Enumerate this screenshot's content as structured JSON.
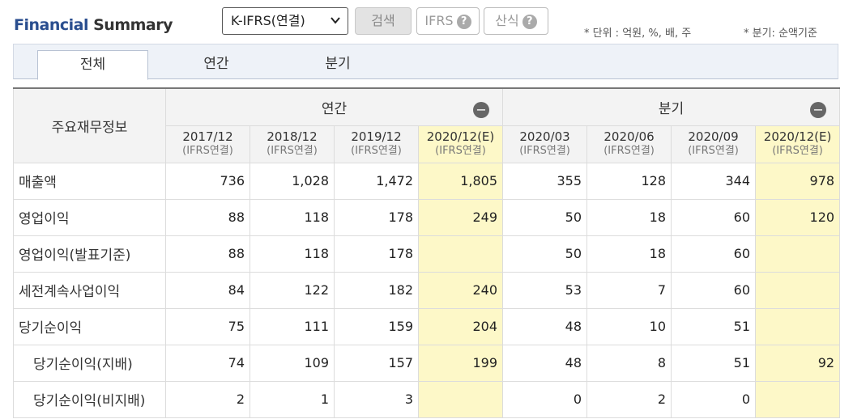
{
  "header": {
    "title_part1": "Financial",
    "title_part2": "Summary",
    "select_value": "K-IFRS(연결)",
    "search_label": "검색",
    "ifrs_label": "IFRS",
    "calc_label": "산식",
    "help_glyph": "?",
    "unit_note": "* 단위 : 억원, %, 배, 주",
    "quarter_note": "* 분기: 순액기준"
  },
  "tabs": [
    {
      "label": "전체",
      "active": true
    },
    {
      "label": "연간",
      "active": false
    },
    {
      "label": "분기",
      "active": false
    }
  ],
  "table": {
    "row_header": "주요재무정보",
    "annual_label": "연간",
    "quarter_label": "분기",
    "collapse_glyph": "−",
    "periods": [
      {
        "date": "2017/12",
        "basis": "(IFRS연결)"
      },
      {
        "date": "2018/12",
        "basis": "(IFRS연결)"
      },
      {
        "date": "2019/12",
        "basis": "(IFRS연결)"
      },
      {
        "date": "2020/12(E)",
        "basis": "(IFRS연결)"
      },
      {
        "date": "2020/03",
        "basis": "(IFRS연결)"
      },
      {
        "date": "2020/06",
        "basis": "(IFRS연결)"
      },
      {
        "date": "2020/09",
        "basis": "(IFRS연결)"
      },
      {
        "date": "2020/12(E)",
        "basis": "(IFRS연결)"
      }
    ],
    "rows": [
      {
        "label": "매출액",
        "indent": false,
        "values": [
          "736",
          "1,028",
          "1,472",
          "1,805",
          "355",
          "128",
          "344",
          "978"
        ]
      },
      {
        "label": "영업이익",
        "indent": false,
        "values": [
          "88",
          "118",
          "178",
          "249",
          "50",
          "18",
          "60",
          "120"
        ]
      },
      {
        "label": "영업이익(발표기준)",
        "indent": false,
        "values": [
          "88",
          "118",
          "178",
          "",
          "50",
          "18",
          "60",
          ""
        ]
      },
      {
        "label": "세전계속사업이익",
        "indent": false,
        "values": [
          "84",
          "122",
          "182",
          "240",
          "53",
          "7",
          "60",
          ""
        ]
      },
      {
        "label": "당기순이익",
        "indent": false,
        "values": [
          "75",
          "111",
          "159",
          "204",
          "48",
          "10",
          "51",
          ""
        ]
      },
      {
        "label": "당기순이익(지배)",
        "indent": true,
        "values": [
          "74",
          "109",
          "157",
          "199",
          "48",
          "8",
          "51",
          "92"
        ]
      },
      {
        "label": "당기순이익(비지배)",
        "indent": true,
        "values": [
          "2",
          "1",
          "3",
          "",
          "0",
          "2",
          "0",
          ""
        ]
      }
    ],
    "highlight_color": "#fdf8c8"
  }
}
